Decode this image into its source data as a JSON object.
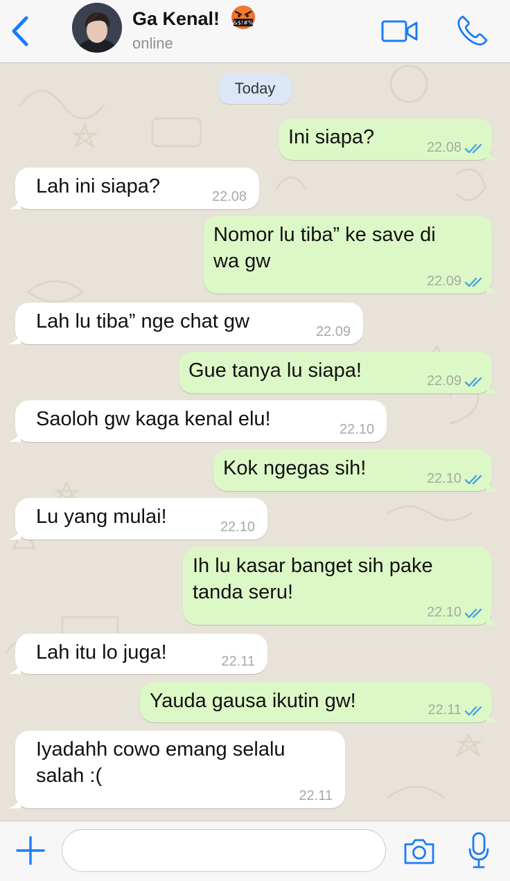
{
  "header": {
    "back_icon": "chevron-left-icon",
    "contact_name": "Ga Kenal!",
    "emoji_label": "&$!#%",
    "status": "online",
    "video_icon": "video-camera-icon",
    "phone_icon": "phone-icon"
  },
  "chat": {
    "date_label": "Today",
    "messages": [
      {
        "direction": "out",
        "lines": [
          "Ini siapa?"
        ],
        "time": "22.08",
        "read": true
      },
      {
        "direction": "in",
        "lines": [
          "Lah ini siapa?"
        ],
        "time": "22.08"
      },
      {
        "direction": "out",
        "lines": [
          "Nomor lu tiba” ke save di",
          "wa gw"
        ],
        "time": "22.09",
        "read": true
      },
      {
        "direction": "in",
        "lines": [
          "Lah lu tiba” nge chat gw"
        ],
        "time": "22.09"
      },
      {
        "direction": "out",
        "lines": [
          "Gue tanya lu siapa!"
        ],
        "time": "22.09",
        "read": true
      },
      {
        "direction": "in",
        "lines": [
          "Saoloh gw kaga kenal elu!"
        ],
        "time": "22.10"
      },
      {
        "direction": "out",
        "lines": [
          "Kok ngegas sih!"
        ],
        "time": "22.10",
        "read": true
      },
      {
        "direction": "in",
        "lines": [
          "Lu yang mulai!"
        ],
        "time": "22.10"
      },
      {
        "direction": "out",
        "lines": [
          "Ih lu kasar banget sih pake",
          "tanda seru!"
        ],
        "time": "22.10",
        "read": true
      },
      {
        "direction": "in",
        "lines": [
          "Lah itu lo juga!"
        ],
        "time": "22.11"
      },
      {
        "direction": "out",
        "lines": [
          "Yauda gausa ikutin gw!"
        ],
        "time": "22.11",
        "read": true
      },
      {
        "direction": "in",
        "lines": [
          "Iyadahh cowo emang selalu",
          "salah :("
        ],
        "time": "22.11"
      }
    ]
  },
  "footer": {
    "attach_icon": "plus-icon",
    "input_value": "",
    "camera_icon": "camera-icon",
    "mic_icon": "microphone-icon"
  },
  "colors": {
    "accent": "#1a7cf5",
    "outgoing_bubble": "#dcf8c6",
    "incoming_bubble": "#ffffff",
    "read_ticks": "#4aa3df",
    "date_pill": "#dbe6f6"
  }
}
